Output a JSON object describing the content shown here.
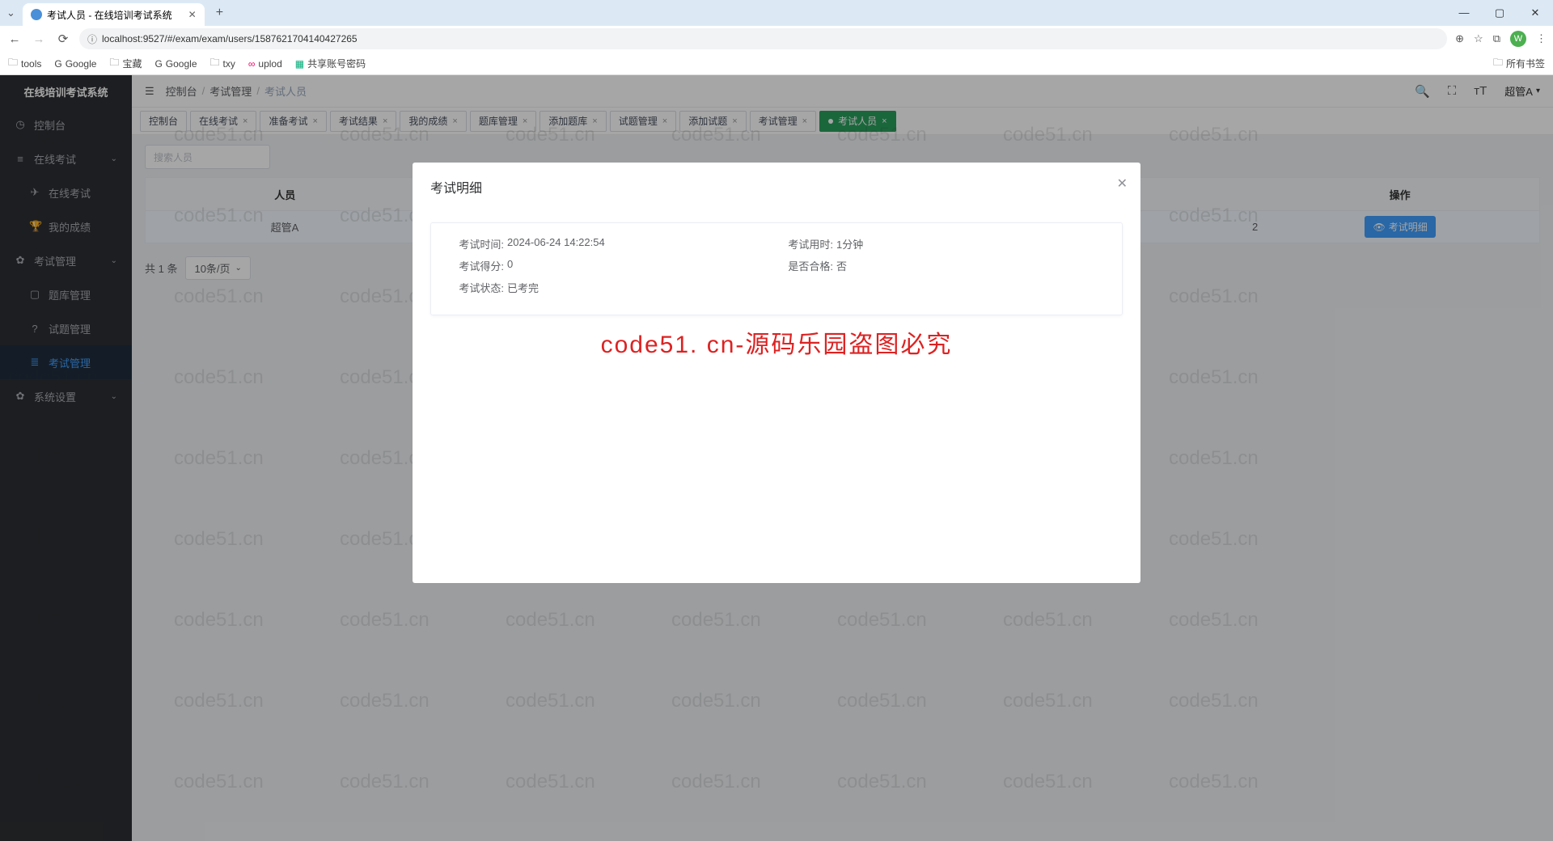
{
  "browser": {
    "tab_title": "考试人员 - 在线培训考试系统",
    "url": "localhost:9527/#/exam/exam/users/1587621704140427265",
    "bookmarks": [
      "tools",
      "Google",
      "宝藏",
      "Google",
      "txy",
      "uplod",
      "共享账号密码"
    ],
    "all_bookmarks": "所有书签",
    "avatar_letter": "W"
  },
  "sidebar": {
    "title": "在线培训考试系统",
    "items": [
      {
        "icon": "◷",
        "label": "控制台",
        "type": "item"
      },
      {
        "icon": "≡",
        "label": "在线考试",
        "type": "group"
      },
      {
        "icon": "✈",
        "label": "在线考试",
        "type": "sub"
      },
      {
        "icon": "🏆",
        "label": "我的成绩",
        "type": "sub"
      },
      {
        "icon": "✿",
        "label": "考试管理",
        "type": "group"
      },
      {
        "icon": "▢",
        "label": "题库管理",
        "type": "sub"
      },
      {
        "icon": "?",
        "label": "试题管理",
        "type": "sub"
      },
      {
        "icon": "≣",
        "label": "考试管理",
        "type": "sub",
        "active": true
      },
      {
        "icon": "✿",
        "label": "系统设置",
        "type": "group"
      }
    ]
  },
  "topbar": {
    "breadcrumbs": [
      "控制台",
      "考试管理",
      "考试人员"
    ],
    "user": "超管A"
  },
  "page_tabs": [
    "控制台",
    "在线考试",
    "准备考试",
    "考试结果",
    "我的成绩",
    "题库管理",
    "添加题库",
    "试题管理",
    "添加试题",
    "考试管理",
    "考试人员"
  ],
  "search": {
    "placeholder": "搜索人员"
  },
  "table": {
    "headers": [
      "人员",
      "",
      "",
      "",
      "操作"
    ],
    "row": {
      "name_prefix": "超管A",
      "val4": "2",
      "action": "考试明细"
    }
  },
  "pagination": {
    "total": "共 1 条",
    "page_size": "10条/页"
  },
  "modal": {
    "title": "考试明细",
    "rows": [
      [
        {
          "label": "考试时间:",
          "value": "2024-06-24 14:22:54"
        },
        {
          "label": "考试用时:",
          "value": "1分钟"
        }
      ],
      [
        {
          "label": "考试得分:",
          "value": "0"
        },
        {
          "label": "是否合格:",
          "value": "否"
        }
      ],
      [
        {
          "label": "考试状态:",
          "value": "已考完"
        }
      ]
    ],
    "watermark_slogan": "code51. cn-源码乐园盗图必究"
  },
  "watermark_tile": "code51.cn"
}
